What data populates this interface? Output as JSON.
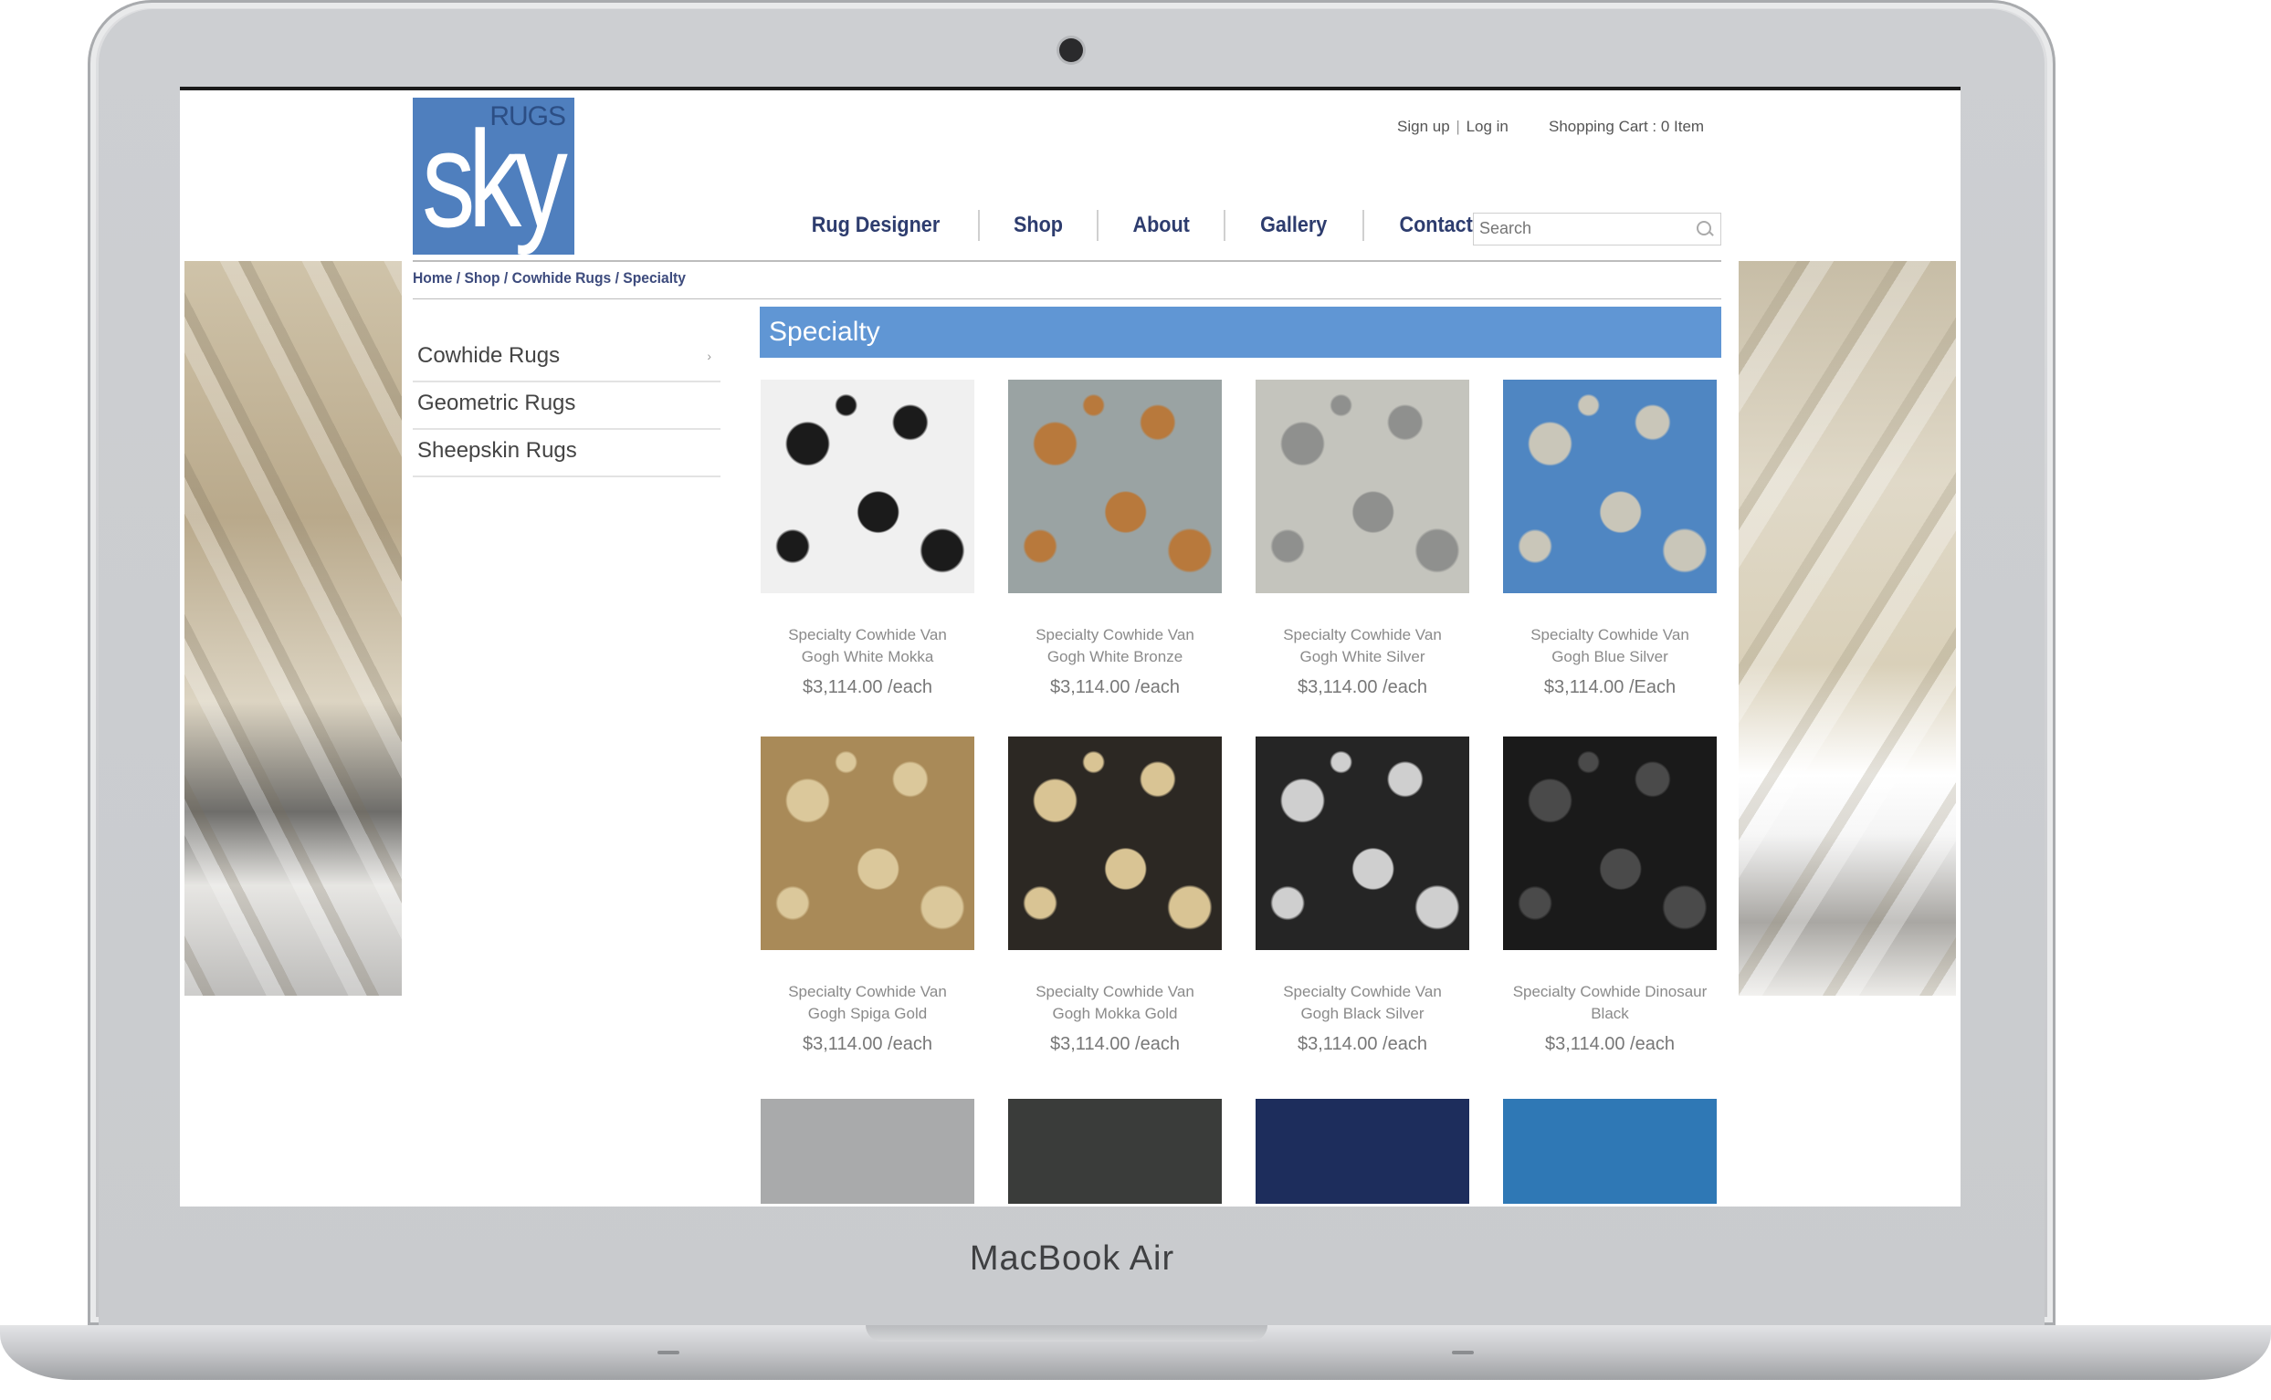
{
  "device": {
    "label": "MacBook Air"
  },
  "site": {
    "logo": {
      "small": "RUGS",
      "big": "sky"
    },
    "top_links": {
      "signup": "Sign up",
      "separator": "|",
      "login": "Log in",
      "cart": "Shopping Cart : 0 Item"
    },
    "nav": [
      "Rug Designer",
      "Shop",
      "About",
      "Gallery",
      "Contact"
    ],
    "search": {
      "placeholder": "Search"
    },
    "breadcrumb": "Home / Shop / Cowhide Rugs / Specialty",
    "categories": [
      {
        "label": "Cowhide Rugs",
        "arrow": "›"
      },
      {
        "label": "Geometric Rugs"
      },
      {
        "label": "Sheepskin Rugs"
      }
    ],
    "page_title": "Specialty",
    "products": [
      {
        "name_line1": "Specialty Cowhide Van",
        "name_line2": "Gogh White Mokka",
        "price": "$3,114.00 /each",
        "colors": [
          "#f0f0f0",
          "#1b1b1b"
        ]
      },
      {
        "name_line1": "Specialty Cowhide Van",
        "name_line2": "Gogh White Bronze",
        "price": "$3,114.00 /each",
        "colors": [
          "#9aa3a3",
          "#b8793c"
        ]
      },
      {
        "name_line1": "Specialty Cowhide Van",
        "name_line2": "Gogh White Silver",
        "price": "$3,114.00 /each",
        "colors": [
          "#c4c4bd",
          "#8f908e"
        ]
      },
      {
        "name_line1": "Specialty Cowhide Van",
        "name_line2": "Gogh Blue Silver",
        "price": "$3,114.00 /Each",
        "colors": [
          "#4f86c2",
          "#c9c6b9"
        ]
      },
      {
        "name_line1": "Specialty Cowhide Van",
        "name_line2": "Gogh Spiga Gold",
        "price": "$3,114.00 /each",
        "colors": [
          "#a98a58",
          "#dbc89b"
        ]
      },
      {
        "name_line1": "Specialty Cowhide Van",
        "name_line2": "Gogh Mokka Gold",
        "price": "$3,114.00 /each",
        "colors": [
          "#2c2823",
          "#d9c494"
        ]
      },
      {
        "name_line1": "Specialty Cowhide Van",
        "name_line2": "Gogh Black Silver",
        "price": "$3,114.00 /each",
        "colors": [
          "#252525",
          "#cfcfcf"
        ]
      },
      {
        "name_line1": "Specialty Cowhide Dinosaur",
        "name_line2": "Black",
        "price": "$3,114.00 /each",
        "colors": [
          "#1a1a1a",
          "#4a4a4a"
        ]
      }
    ],
    "partial_row_colors": [
      "#a9aaab",
      "#3a3c3a",
      "#1d2d5c",
      "#2f78b5"
    ]
  }
}
